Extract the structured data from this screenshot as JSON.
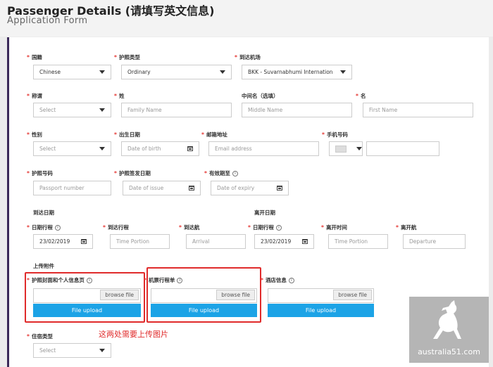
{
  "header": {
    "title": "Passenger Details (请填写英文信息)",
    "subtitle": "Application Form"
  },
  "form": {
    "nationality": {
      "label": "国籍",
      "value": "Chinese"
    },
    "passport_type": {
      "label": "护照类型",
      "value": "Ordinary"
    },
    "arrival_airport": {
      "label": "到达机场",
      "value": "BKK - Suvarnabhumi Internation"
    },
    "title_field": {
      "label": "称谓",
      "placeholder": "Select"
    },
    "surname": {
      "label": "姓",
      "placeholder": "Family Name"
    },
    "middle_name": {
      "label": "中间名（选填）",
      "placeholder": "Middle Name"
    },
    "given_name": {
      "label": "名",
      "placeholder": "First Name"
    },
    "gender": {
      "label": "性别",
      "placeholder": "Select"
    },
    "dob": {
      "label": "出生日期",
      "placeholder": "Date of birth"
    },
    "email": {
      "label": "邮箱地址",
      "placeholder": "Email address"
    },
    "phone": {
      "label": "手机号码",
      "placeholder": ""
    },
    "passport_no": {
      "label": "护照号码",
      "placeholder": "Passport number"
    },
    "issue_date": {
      "label": "护照签发日期",
      "placeholder": "Date of issue"
    },
    "expiry_date": {
      "label": "有效期至",
      "placeholder": "Date of expiry"
    },
    "arrival_section": "到达日期",
    "departure_section": "离开日期",
    "arr_date": {
      "label": "日期行程",
      "value": "23/02/2019"
    },
    "arr_time": {
      "label": "到达行程",
      "placeholder": "Time Portion"
    },
    "arr_flight": {
      "label": "到达航",
      "placeholder": "Arrival"
    },
    "dep_date": {
      "label": "日期行程",
      "value": "23/02/2019"
    },
    "dep_time": {
      "label": "离开时间",
      "placeholder": "Time Portion"
    },
    "dep_flight": {
      "label": "离开航",
      "placeholder": "Departure"
    },
    "upload_section": "上传附件",
    "uploads": [
      {
        "label": "护照封面和个人信息页",
        "browse": "browse file",
        "button": "File upload"
      },
      {
        "label": "机票行程单",
        "browse": "browse file",
        "button": "File upload"
      },
      {
        "label": "酒店信息",
        "browse": "browse file",
        "button": "File upload"
      }
    ],
    "accommodation": {
      "label": "住宿类型",
      "placeholder": "Select"
    }
  },
  "annotation": "这两处需要上传图片",
  "watermark": "australia51.com",
  "colors": {
    "required": "#e53935",
    "accent": "#1ca3e6",
    "annotation": "#e02b2b",
    "sidebar": "#3b2a59"
  }
}
